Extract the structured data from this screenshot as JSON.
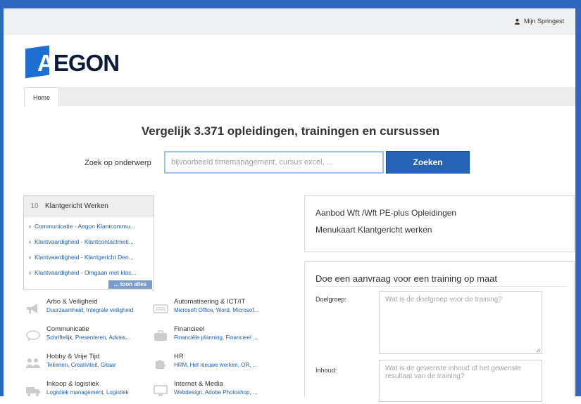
{
  "header": {
    "user_link": "Mijn Springest"
  },
  "brand": {
    "logo_letter": "A",
    "logo_rest": "EGON"
  },
  "breadcrumb": {
    "home": "Home"
  },
  "hero": {
    "title": "Vergelijk 3.371 opleidingen, trainingen en cursussen"
  },
  "search": {
    "label": "Zoek op onderwerp",
    "placeholder": "bijvoorbeeld timemanagement, cursus excel, ...",
    "button": "Zoeken"
  },
  "featured": {
    "count": "10",
    "title": "Klantgericht Werken",
    "items": [
      "Communicatie - Aegon Klantcommu...",
      "Klantvaardigheid - Klantcontactmeti...",
      "Klantvaardigheid - Klantgericht Den...",
      "Klantvaardigheid - Omgaan met klac..."
    ],
    "more": "... toon alles"
  },
  "categories": [
    {
      "name": "Arbo & Veiligheid",
      "subs": "Duurzaamheid, Integrale veiligheid",
      "icon": "megaphone-icon"
    },
    {
      "name": "Automatisering & ICT/IT",
      "subs": "Microsoft Office, Word, Microsof...",
      "icon": "keyboard-icon"
    },
    {
      "name": "Communicatie",
      "subs": "Schriftelijk, Presenteren, Advies...",
      "icon": "speech-bubble-icon"
    },
    {
      "name": "Financieel",
      "subs": "Financiële planning, Financieel ...",
      "icon": "briefcase-icon"
    },
    {
      "name": "Hobby & Vrije Tijd",
      "subs": "Tekenen, Creativiteit, Gitaar",
      "icon": "people-icon"
    },
    {
      "name": "HR",
      "subs": "HRM, Het nieuwe werken, OR, ...",
      "icon": "puzzle-icon"
    },
    {
      "name": "Inkoop & logistiek",
      "subs": "Logistiek management, Logistiek",
      "icon": "truck-icon"
    },
    {
      "name": "Internet & Media",
      "subs": "Webdesign, Adobe Photoshop, ...",
      "icon": "monitor-icon"
    }
  ],
  "offer_panel": {
    "line1": "Aanbod Wft /Wft PE-plus Opleidingen",
    "line2": "Menukaart Klantgericht werken"
  },
  "request_form": {
    "heading": "Doe een aanvraag voor een training op maat",
    "fields": [
      {
        "label": "Doelgroep:",
        "placeholder": "Wat is de doelgroep voor de training?"
      },
      {
        "label": "Inhoud:",
        "placeholder": "Wat is de gewenste inhoud of het gewenste resultaat van de training?"
      }
    ]
  },
  "colors": {
    "frame": "#2f66c0",
    "button": "#2663b5",
    "link": "#1a5fb0",
    "logo_blue": "#1d6fd1",
    "logo_navy": "#0b1b3a"
  }
}
